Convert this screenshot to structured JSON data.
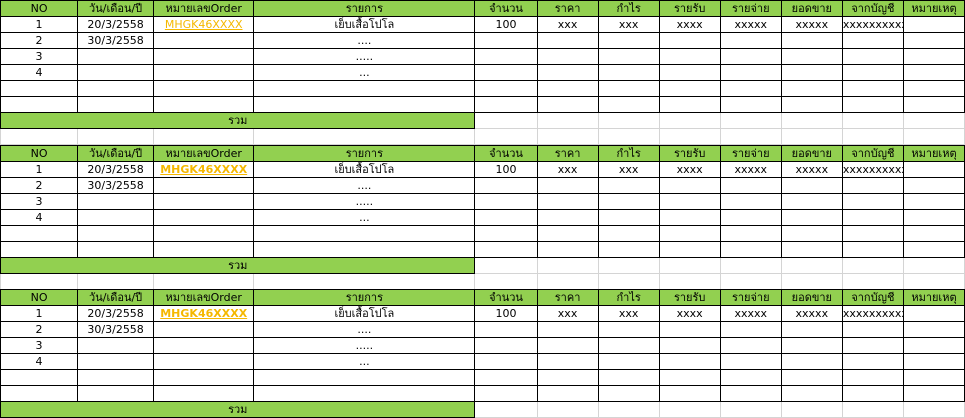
{
  "headers": [
    "NO",
    "วัน/เดือน/ปี",
    "หมายเลขOrder",
    "รายการ",
    "จำนวน",
    "ราคา",
    "กำไร",
    "รายรับ",
    "รายจ่าย",
    "ยอดขาย",
    "จากบัญชี",
    "หมายเหตุ"
  ],
  "sum_label": "รวม",
  "blocks": [
    {
      "rows": [
        {
          "no": "1",
          "date": "20/3/2558",
          "order": "MHGK46XXXX",
          "item": "เย็บเสื้อโปโล",
          "qty": "100",
          "price": "xxx",
          "profit": "xxx",
          "income": "xxxx",
          "expense": "xxxxx",
          "sales": "xxxxx",
          "account": "xxxxxxxxxxx",
          "note": ""
        },
        {
          "no": "2",
          "date": "30/3/2558",
          "order": "",
          "item": "....",
          "qty": "",
          "price": "",
          "profit": "",
          "income": "",
          "expense": "",
          "sales": "",
          "account": "",
          "note": ""
        },
        {
          "no": "3",
          "date": "",
          "order": "",
          "item": ".....",
          "qty": "",
          "price": "",
          "profit": "",
          "income": "",
          "expense": "",
          "sales": "",
          "account": "",
          "note": ""
        },
        {
          "no": "4",
          "date": "",
          "order": "",
          "item": "...",
          "qty": "",
          "price": "",
          "profit": "",
          "income": "",
          "expense": "",
          "sales": "",
          "account": "",
          "note": ""
        }
      ]
    },
    {
      "rows": [
        {
          "no": "1",
          "date": "20/3/2558",
          "order": "MHGK46XXXX",
          "item": "เย็บเสื้อโปโล",
          "qty": "100",
          "price": "xxx",
          "profit": "xxx",
          "income": "xxxx",
          "expense": "xxxxx",
          "sales": "xxxxx",
          "account": "xxxxxxxxxxx",
          "note": ""
        },
        {
          "no": "2",
          "date": "30/3/2558",
          "order": "",
          "item": "....",
          "qty": "",
          "price": "",
          "profit": "",
          "income": "",
          "expense": "",
          "sales": "",
          "account": "",
          "note": ""
        },
        {
          "no": "3",
          "date": "",
          "order": "",
          "item": ".....",
          "qty": "",
          "price": "",
          "profit": "",
          "income": "",
          "expense": "",
          "sales": "",
          "account": "",
          "note": ""
        },
        {
          "no": "4",
          "date": "",
          "order": "",
          "item": "...",
          "qty": "",
          "price": "",
          "profit": "",
          "income": "",
          "expense": "",
          "sales": "",
          "account": "",
          "note": ""
        }
      ]
    },
    {
      "rows": [
        {
          "no": "1",
          "date": "20/3/2558",
          "order": "MHGK46XXXX",
          "item": "เย็บเสื้อโปโล",
          "qty": "100",
          "price": "xxx",
          "profit": "xxx",
          "income": "xxxx",
          "expense": "xxxxx",
          "sales": "xxxxx",
          "account": "xxxxxxxxxxx",
          "note": ""
        },
        {
          "no": "2",
          "date": "30/3/2558",
          "order": "",
          "item": "....",
          "qty": "",
          "price": "",
          "profit": "",
          "income": "",
          "expense": "",
          "sales": "",
          "account": "",
          "note": ""
        },
        {
          "no": "3",
          "date": "",
          "order": "",
          "item": ".....",
          "qty": "",
          "price": "",
          "profit": "",
          "income": "",
          "expense": "",
          "sales": "",
          "account": "",
          "note": ""
        },
        {
          "no": "4",
          "date": "",
          "order": "",
          "item": "...",
          "qty": "",
          "price": "",
          "profit": "",
          "income": "",
          "expense": "",
          "sales": "",
          "account": "",
          "note": ""
        }
      ]
    }
  ],
  "colors": {
    "header_green": "#92d050",
    "order_link": "#f5b800",
    "grid": "#d4d4d4"
  }
}
